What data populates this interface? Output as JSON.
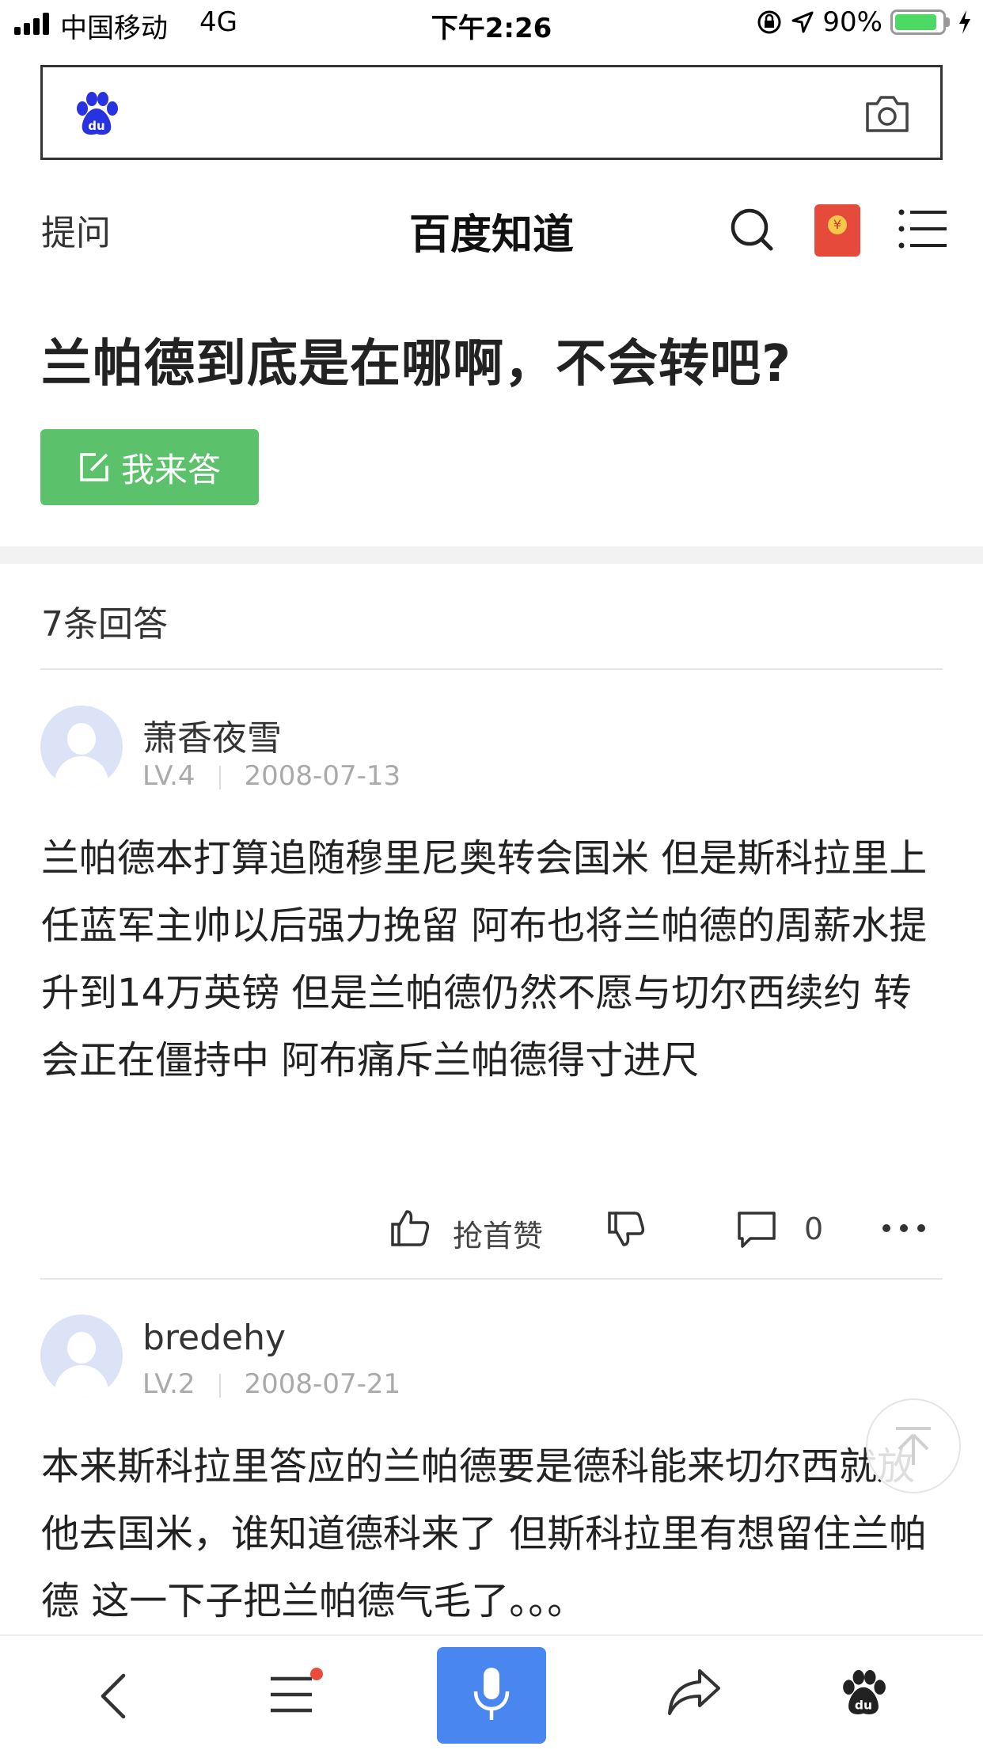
{
  "status_bar": {
    "carrier": "中国移动",
    "network": "4G",
    "time": "下午2:26",
    "battery_pct": "90%",
    "battery_level": 0.9
  },
  "search": {
    "logo_icon": "baidu-paw-icon",
    "camera_icon": "camera-icon"
  },
  "header": {
    "ask_label": "提问",
    "title": "百度知道",
    "search_icon": "search-icon",
    "redpacket_icon": "red-packet-icon",
    "menu_icon": "list-menu-icon"
  },
  "question": {
    "title": "兰帕德到底是在哪啊，不会转吧?",
    "answer_button": "我来答"
  },
  "answers_count": "7条回答",
  "answers": [
    {
      "user": "萧香夜雪",
      "level": "LV.4",
      "date": "2008-07-13",
      "body": "兰帕德本打算追随穆里尼奥转会国米 但是斯科拉里上任蓝军主帅以后强力挽留 阿布也将兰帕德的周薪水提升到14万英镑 但是兰帕德仍然不愿与切尔西续约 转会正在僵持中 阿布痛斥兰帕德得寸进尺",
      "like_label": "抢首赞",
      "comment_count": "0"
    },
    {
      "user": "bredehy",
      "level": "LV.2",
      "date": "2008-07-21",
      "body": "本来斯科拉里答应的兰帕德要是德科能来切尔西就放他去国米，谁知道德科来了 但斯科拉里有想留住兰帕德 这一下子把兰帕德气毛了。。。"
    }
  ],
  "colors": {
    "green_button": "#5bc16b",
    "mic_blue": "#4a86f0",
    "red_dot": "#e84c3d",
    "baidu_blue": "#2932e1"
  }
}
